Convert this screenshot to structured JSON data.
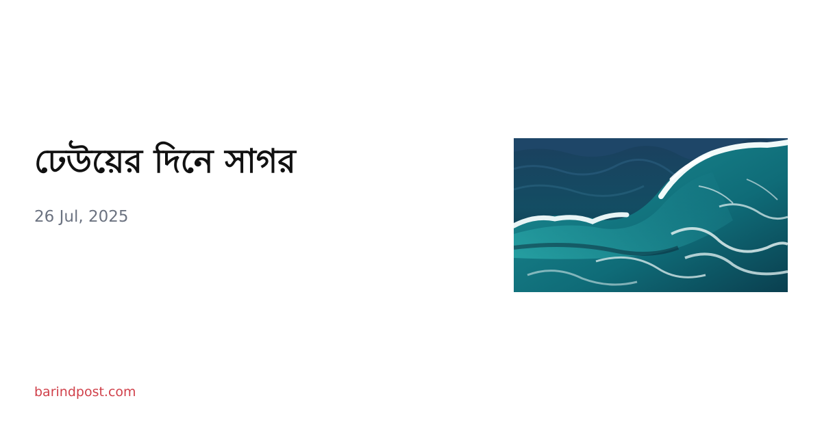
{
  "article": {
    "title": "ঢেউয়ের দিনে সাগর",
    "date": "26 Jul, 2025",
    "site": "barindpost.com"
  },
  "thumbnail": {
    "icon": "ocean-wave-image"
  },
  "colors": {
    "title": "#111111",
    "date": "#6b7280",
    "site": "#d0404a",
    "background": "#ffffff"
  }
}
